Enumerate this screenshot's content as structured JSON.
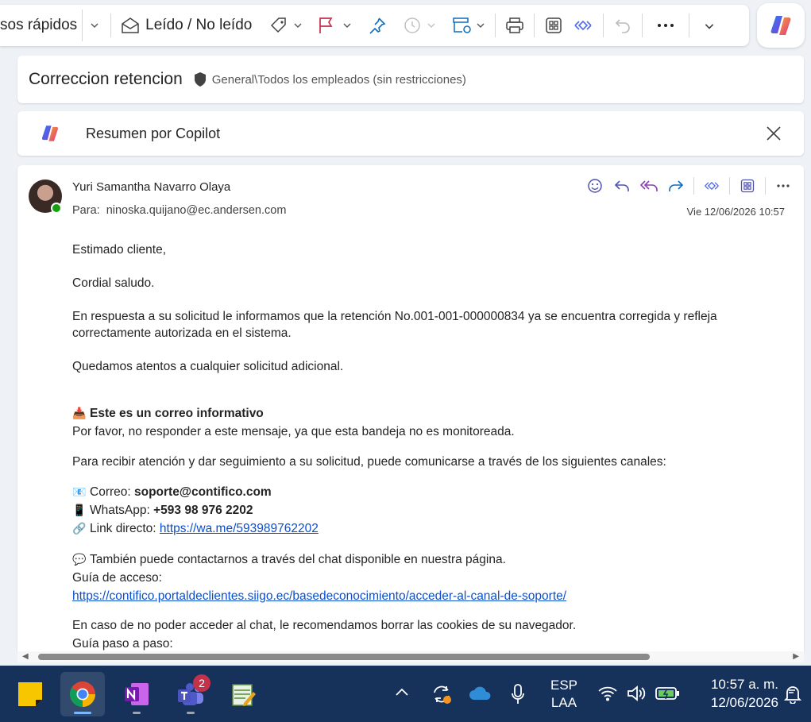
{
  "toolbar": {
    "quick_steps": "sos rápidos",
    "read_unread": "Leído / No leído"
  },
  "subject": {
    "title": "Correccion retencion",
    "label": "General\\Todos los empleados (sin restricciones)"
  },
  "copilot_summary": {
    "title": "Resumen por Copilot"
  },
  "message": {
    "sender": "Yuri Samantha Navarro Olaya",
    "to_label": "Para:",
    "to_address": "ninoska.quijano@ec.andersen.com",
    "date": "Vie 12/06/2026 10:57",
    "body": {
      "greeting": "Estimado cliente,",
      "salute": "Cordial saludo.",
      "para1": "En respuesta a su solicitud le informamos que la retención No.001-001-000000834   ya se encuentra corregida y refleja correctamente autorizada en el sistema.",
      "para2": "Quedamos atentos a cualquier solicitud adicional.",
      "info_title": "Este es un correo informativo",
      "info_text": "Por favor, no responder a este mensaje, ya que esta bandeja no es monitoreada.",
      "channels_intro": "Para recibir atención y dar seguimiento a su solicitud, puede comunicarse a través de los siguientes canales:",
      "email_label": "Correo: ",
      "email_value": "soporte@contifico.com",
      "whatsapp_label": "WhatsApp: ",
      "whatsapp_value": "+593 98 976 2202",
      "link_label": "Link directo: ",
      "link_value": "https://wa.me/593989762202",
      "chat_text": "También puede contactarnos a través del chat disponible en nuestra página.",
      "guide_label": "Guía de acceso:",
      "guide_link": "https://contifico.portaldeclientes.siigo.ec/basedeconocimiento/acceder-al-canal-de-soporte/",
      "cookies_text": "En caso de no poder acceder al chat, le recomendamos borrar las cookies de su navegador.",
      "step_guide": "Guía paso a paso:"
    }
  },
  "taskbar": {
    "teams_badge": "2",
    "lang_top": "ESP",
    "lang_bottom": "LAA",
    "time": "10:57 a. m.",
    "date": "12/06/2026"
  }
}
